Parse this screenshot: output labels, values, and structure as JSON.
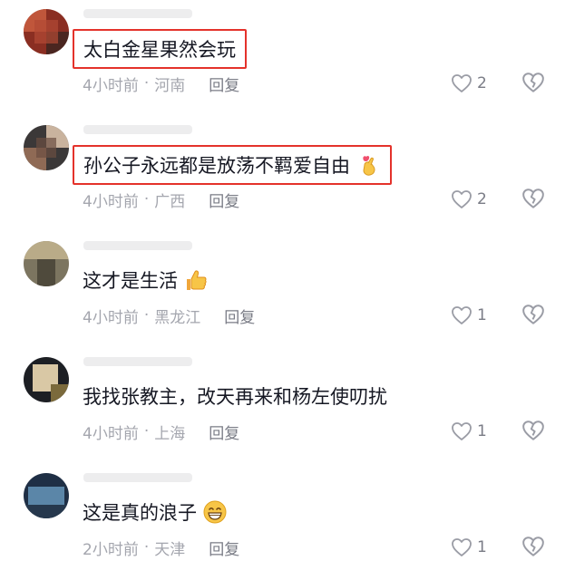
{
  "comments": [
    {
      "text": "太白金星果然会玩",
      "time": "4小时前",
      "location": "河南",
      "reply_label": "回复",
      "likes": "2",
      "highlighted": true,
      "emoji": null,
      "avatar_colors": [
        "#8a2e22",
        "#c0563b",
        "#4a2620"
      ]
    },
    {
      "text": "孙公子永远都是放荡不羁爱自由",
      "time": "4小时前",
      "location": "广西",
      "reply_label": "回复",
      "likes": "2",
      "highlighted": true,
      "emoji": "finger-heart-emoji",
      "avatar_colors": [
        "#3b3838",
        "#8f6a55",
        "#c9b39e"
      ]
    },
    {
      "text": "这才是生活",
      "time": "4小时前",
      "location": "黑龙江",
      "reply_label": "回复",
      "likes": "1",
      "highlighted": false,
      "emoji": "thumbs-up-emoji",
      "avatar_colors": [
        "#7c7560",
        "#b9ab88",
        "#4f4a3c"
      ]
    },
    {
      "text": "我找张教主，改天再来和杨左使叨扰",
      "time": "4小时前",
      "location": "上海",
      "reply_label": "回复",
      "likes": "1",
      "highlighted": false,
      "emoji": null,
      "avatar_colors": [
        "#1d1f24",
        "#d9c8a5",
        "#7b6a3c"
      ]
    },
    {
      "text": "这是真的浪子",
      "time": "2小时前",
      "location": "天津",
      "reply_label": "回复",
      "likes": "1",
      "highlighted": false,
      "emoji": "grinning-emoji",
      "avatar_colors": [
        "#1f2f45",
        "#5b86a8",
        "#26384d"
      ]
    }
  ],
  "separator": "·",
  "colors": {
    "highlight_box": "#e4322b",
    "text": "#161823",
    "meta": "#a4a6ae",
    "icon": "#9a9ca5"
  }
}
